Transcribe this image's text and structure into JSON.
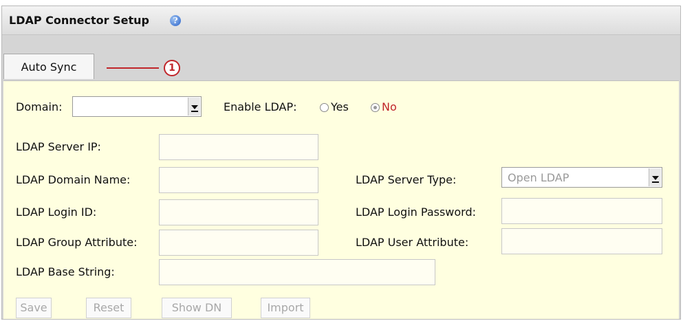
{
  "header": {
    "title": "LDAP Connector Setup",
    "help_icon": "question-mark-icon"
  },
  "tabs": [
    {
      "label": "Auto Sync",
      "active": true
    }
  ],
  "annotation": {
    "number": "1",
    "color": "#c0252a"
  },
  "form": {
    "domain_label": "Domain:",
    "domain_value": "",
    "enable_ldap_label": "Enable LDAP:",
    "enable_yes": "Yes",
    "enable_no": "No",
    "enable_selected": "No",
    "server_ip_label": "LDAP Server IP:",
    "domain_name_label": "LDAP Domain Name:",
    "login_id_label": "LDAP Login ID:",
    "group_attr_label": "LDAP Group Attribute:",
    "base_string_label": "LDAP Base String:",
    "server_type_label": "LDAP Server Type:",
    "server_type_value": "Open LDAP",
    "login_password_label": "LDAP Login Password:",
    "user_attr_label": "LDAP User Attribute:"
  },
  "buttons": {
    "save": "Save",
    "reset": "Reset",
    "show_dn": "Show DN",
    "import": "Import"
  },
  "colors": {
    "panel_bg": "#ffffe0",
    "no_option": "#c0252a",
    "disabled_text": "#a8a8a8"
  }
}
